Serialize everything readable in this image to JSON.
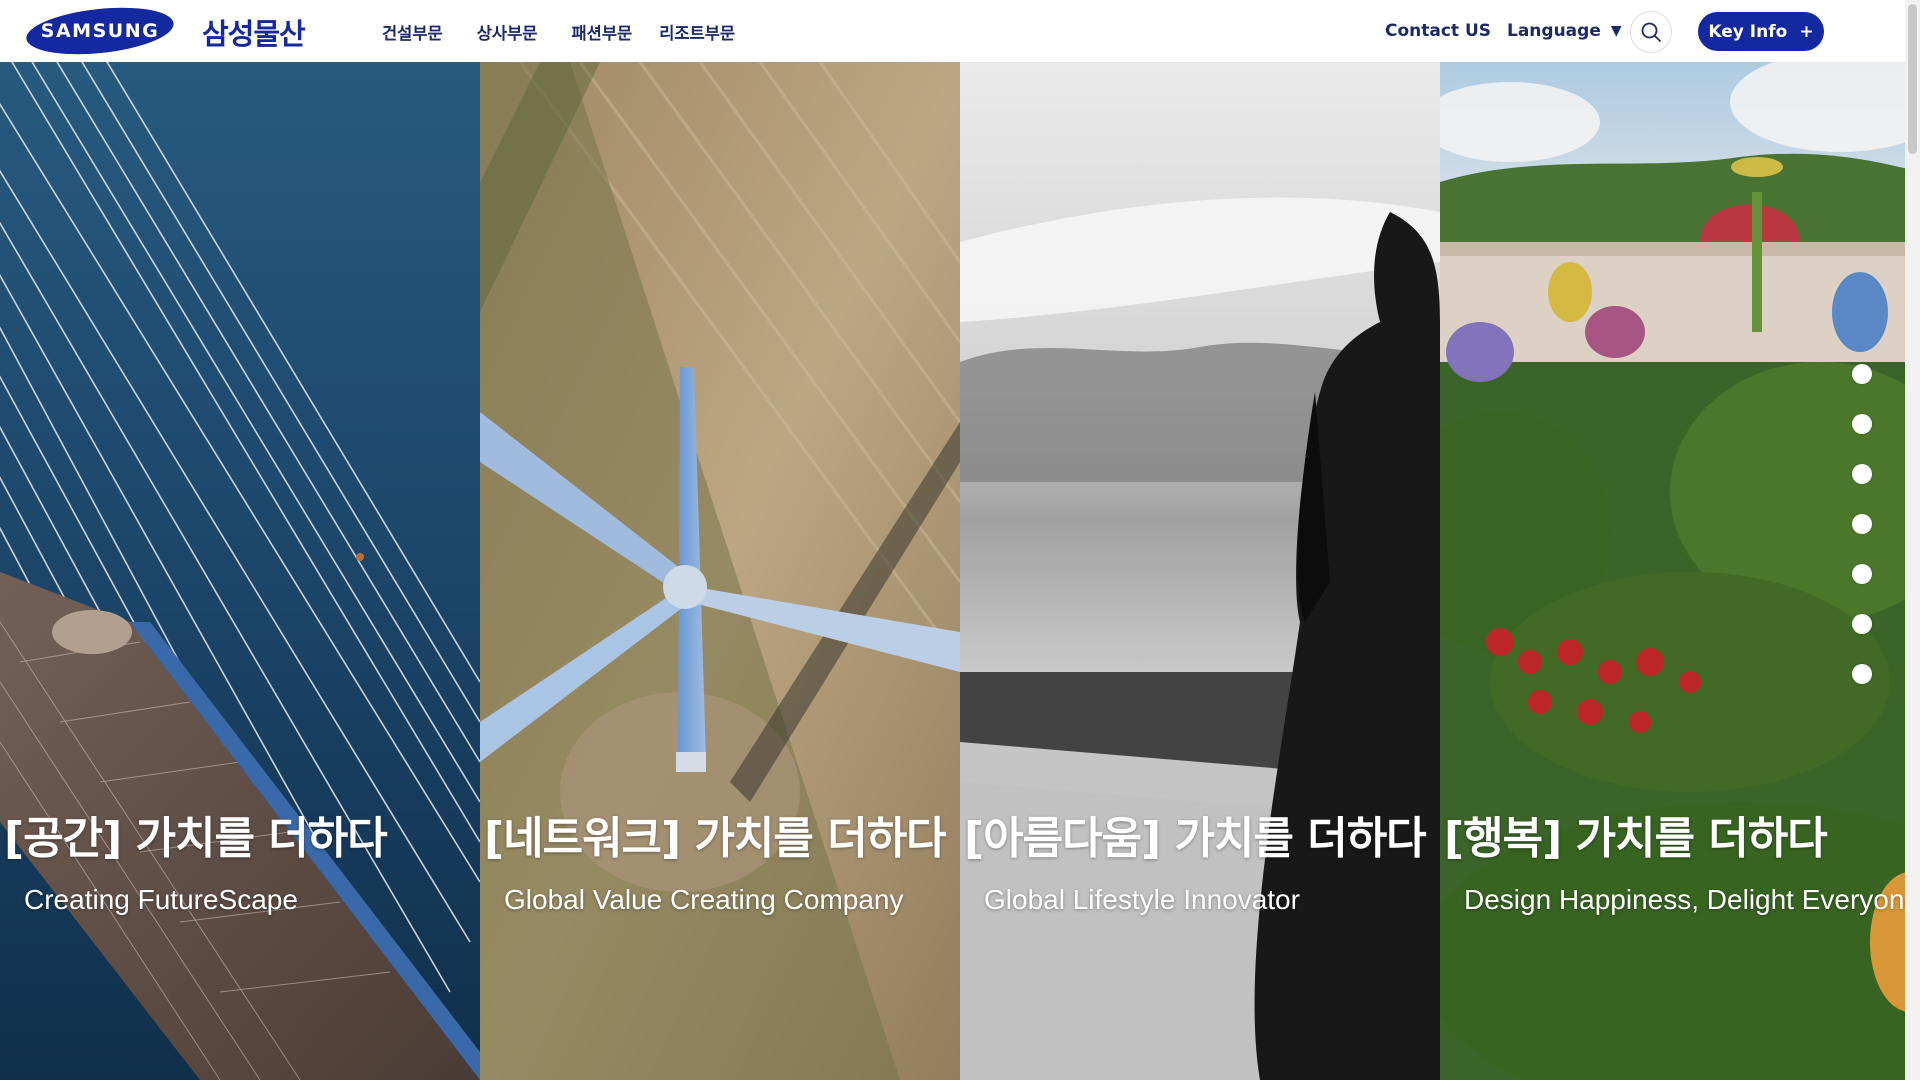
{
  "header": {
    "logo_text": "SAMSUNG",
    "corp_name": "삼성물산",
    "nav": [
      {
        "label": "건설부문"
      },
      {
        "label": "상사부문"
      },
      {
        "label": "패션부문"
      },
      {
        "label": "리조트부문"
      }
    ],
    "contact_label": "Contact US",
    "language_label": "Language",
    "language_caret": "▼",
    "key_info_label": "Key Info",
    "key_info_plus": "+",
    "brand_color": "#1428a0",
    "nav_text_color": "#1c2a6b"
  },
  "panels": [
    {
      "title": "[공간] 가치를 더하다",
      "subtitle": "Creating FutureScape",
      "scene": "cable-stayed bridge over water"
    },
    {
      "title": "[네트워크] 가치를 더하다",
      "subtitle": "Global Value Creating Company",
      "scene": "aerial view of wind turbine over field"
    },
    {
      "title": "[아름다움] 가치를 더하다",
      "subtitle": "Global Lifestyle Innovator",
      "scene": "black and white figure in black coat"
    },
    {
      "title": "[행복] 가치를 더하다",
      "subtitle": "Design Happiness, Delight Everyone",
      "scene": "theme park garden"
    }
  ],
  "pagination": {
    "count": 7,
    "icon": "dot-icon"
  },
  "icons": {
    "search": "search-icon"
  }
}
